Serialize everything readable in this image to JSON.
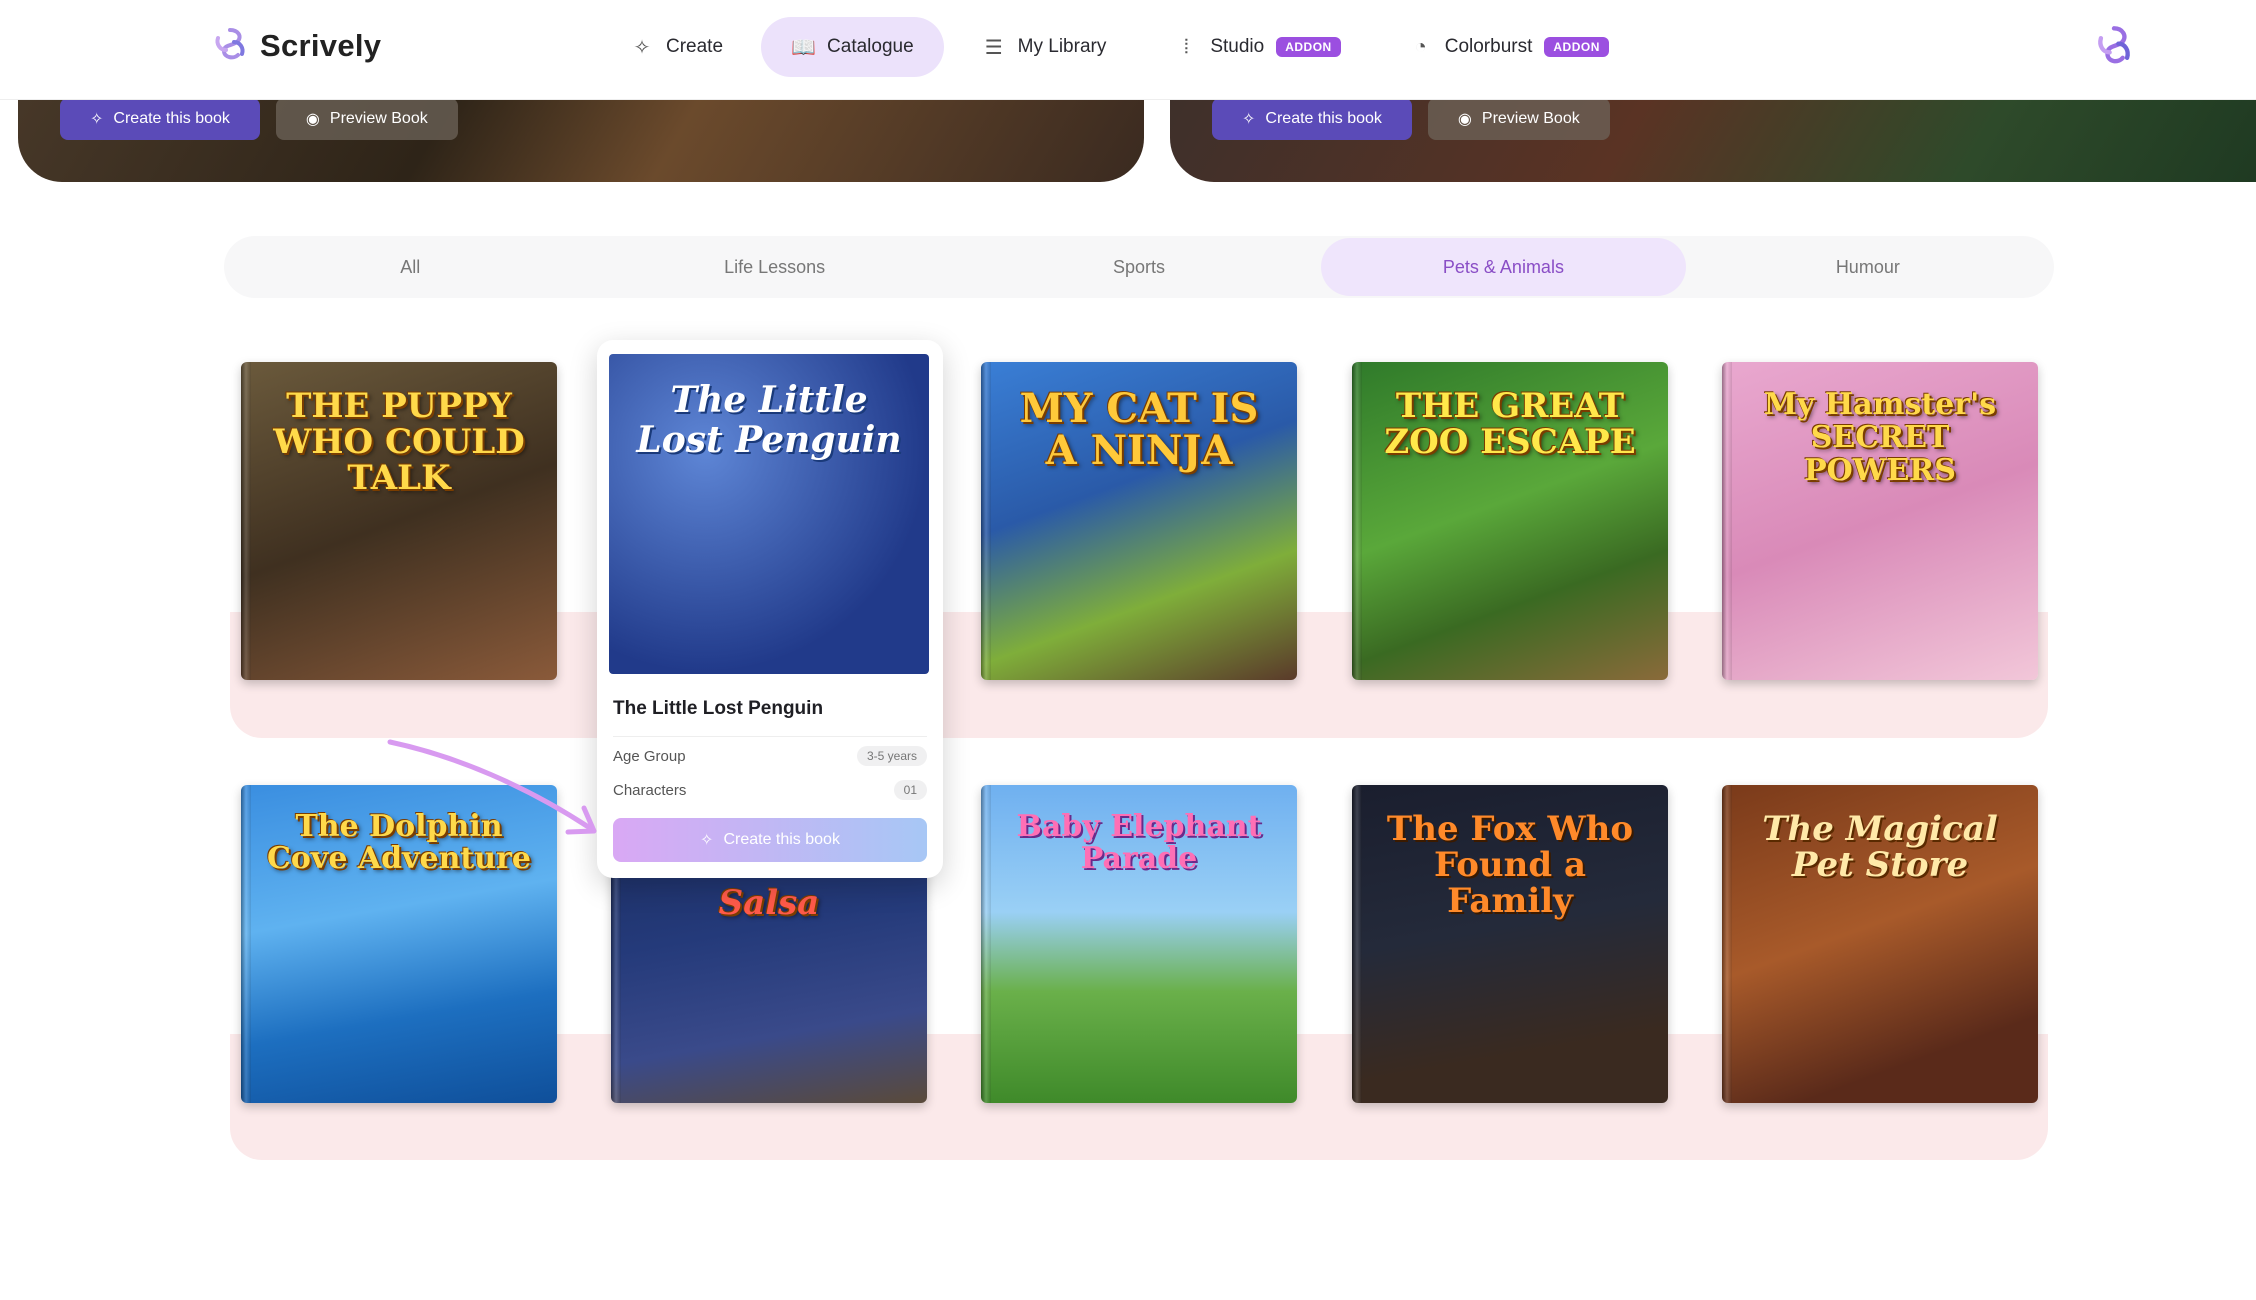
{
  "brand": {
    "name": "Scrively"
  },
  "nav": {
    "items": [
      {
        "label": "Create",
        "icon": "sparkle-icon"
      },
      {
        "label": "Catalogue",
        "icon": "book-icon",
        "active": true
      },
      {
        "label": "My Library",
        "icon": "library-icon"
      },
      {
        "label": "Studio",
        "icon": "waveform-icon",
        "badge": "ADDON"
      },
      {
        "label": "Colorburst",
        "icon": "palette-icon",
        "badge": "ADDON"
      }
    ]
  },
  "hero": {
    "left": {
      "create_label": "Create this book",
      "preview_label": "Preview Book"
    },
    "right": {
      "create_label": "Create this book",
      "preview_label": "Preview Book"
    }
  },
  "tabs": [
    {
      "label": "All"
    },
    {
      "label": "Life Lessons"
    },
    {
      "label": "Sports"
    },
    {
      "label": "Pets & Animals",
      "active": true
    },
    {
      "label": "Humour"
    }
  ],
  "books": [
    {
      "title": "THE PUPPY WHO COULD TALK"
    },
    {
      "title": "The Little Lost Penguin"
    },
    {
      "title": "MY CAT IS A NINJA"
    },
    {
      "title": "THE GREAT ZOO ESCAPE"
    },
    {
      "title": "My Hamster's SECRET POWERS"
    },
    {
      "title": "The Dolphin Cove Adventure"
    },
    {
      "title": "Salsa"
    },
    {
      "title": "Baby Elephant Parade"
    },
    {
      "title": "The Fox Who Found a Family"
    },
    {
      "title": "The Magical Pet Store"
    }
  ],
  "popup": {
    "title": "The Little Lost Penguin",
    "age_group_label": "Age Group",
    "age_group_value": "3-5 years",
    "characters_label": "Characters",
    "characters_value": "01",
    "create_label": "Create this book"
  },
  "colors": {
    "accent": "#9b4fe0",
    "active_tab_bg": "#efe5fc",
    "shelf": "#fbe9ea"
  }
}
